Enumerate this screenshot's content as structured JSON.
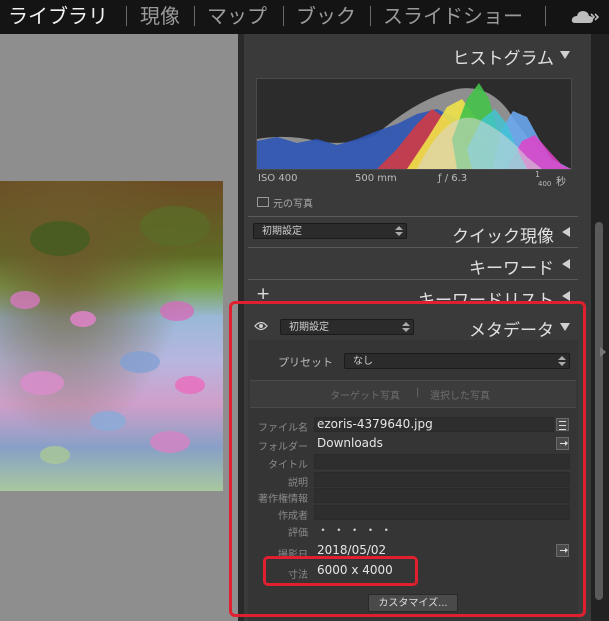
{
  "modules": [
    "ライブラリ",
    "現像",
    "マップ",
    "ブック",
    "スライドショー"
  ],
  "histogram": {
    "title": "ヒストグラム",
    "iso": "ISO 400",
    "focal": "500 mm",
    "aperture": "ƒ / 6.3",
    "shutter_num": "1",
    "shutter_den": "400",
    "shutter_unit": "秒",
    "original_photo_label": "元の写真"
  },
  "quick_develop": {
    "preset": "初期設定",
    "title": "クイック現像"
  },
  "keywording": {
    "title": "キーワード"
  },
  "keyword_list": {
    "title": "キーワードリスト",
    "add_symbol": "+"
  },
  "metadata": {
    "preset": "初期設定",
    "title": "メタデータ",
    "preset_label": "プリセット",
    "preset_value": "なし",
    "target_photo": "ターゲット写真",
    "selected_photos": "選択した写真",
    "separator": "|",
    "fields": {
      "filename": {
        "label": "ファイル名",
        "value": "ezoris-4379640.jpg"
      },
      "folder": {
        "label": "フォルダー",
        "value": "Downloads"
      },
      "title": {
        "label": "タイトル",
        "value": ""
      },
      "caption": {
        "label": "説明",
        "value": ""
      },
      "copyright": {
        "label": "著作権情報",
        "value": ""
      },
      "creator": {
        "label": "作成者",
        "value": ""
      },
      "rating": {
        "label": "評価",
        "value": "・ ・ ・ ・ ・"
      },
      "capture_date": {
        "label": "撮影日",
        "value": "2018/05/02"
      },
      "dimensions": {
        "label": "寸法",
        "value": "6000 x 4000"
      }
    },
    "customize_button": "カスタマイズ..."
  },
  "colors": {
    "highlight": "#e0202e",
    "panel_bg": "#3a3a3a",
    "topbar_bg": "#141414"
  }
}
